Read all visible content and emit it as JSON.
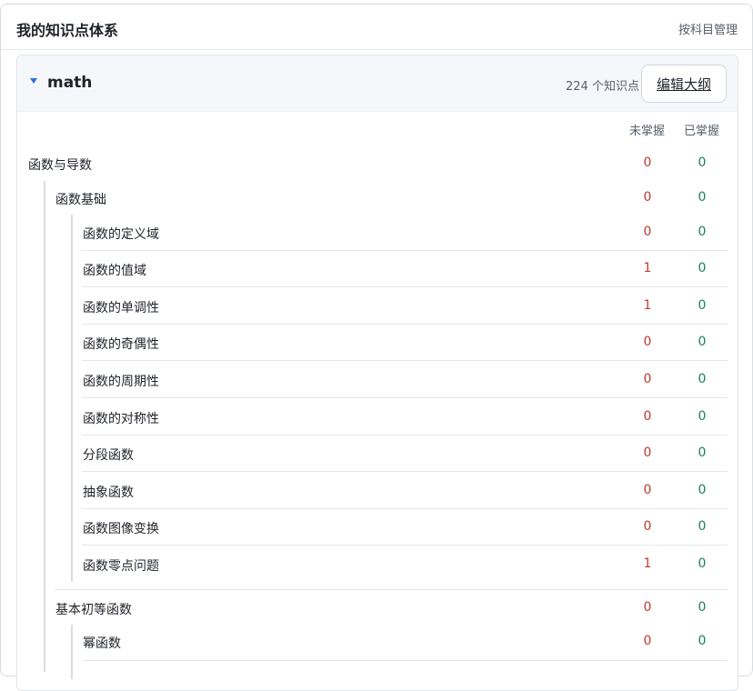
{
  "header": {
    "title": "我的知识点体系",
    "manage_link": "按科目管理"
  },
  "subject": {
    "name": "math",
    "count_text": "224 个知识点",
    "edit_button": "编辑大纲"
  },
  "columns": {
    "unmastered": "未掌握",
    "mastered": "已掌握"
  },
  "tree": {
    "l1": {
      "label": "函数与导数",
      "unmastered": "0",
      "mastered": "0"
    },
    "l2a": {
      "label": "函数基础",
      "unmastered": "0",
      "mastered": "0"
    },
    "l3": [
      {
        "label": "函数的定义域",
        "unmastered": "0",
        "mastered": "0"
      },
      {
        "label": "函数的值域",
        "unmastered": "1",
        "mastered": "0"
      },
      {
        "label": "函数的单调性",
        "unmastered": "1",
        "mastered": "0"
      },
      {
        "label": "函数的奇偶性",
        "unmastered": "0",
        "mastered": "0"
      },
      {
        "label": "函数的周期性",
        "unmastered": "0",
        "mastered": "0"
      },
      {
        "label": "函数的对称性",
        "unmastered": "0",
        "mastered": "0"
      },
      {
        "label": "分段函数",
        "unmastered": "0",
        "mastered": "0"
      },
      {
        "label": "抽象函数",
        "unmastered": "0",
        "mastered": "0"
      },
      {
        "label": "函数图像变换",
        "unmastered": "0",
        "mastered": "0"
      },
      {
        "label": "函数零点问题",
        "unmastered": "1",
        "mastered": "0"
      }
    ],
    "l2b": {
      "label": "基本初等函数",
      "unmastered": "0",
      "mastered": "0"
    },
    "l3b": [
      {
        "label": "幂函数",
        "unmastered": "0",
        "mastered": "0"
      }
    ]
  }
}
